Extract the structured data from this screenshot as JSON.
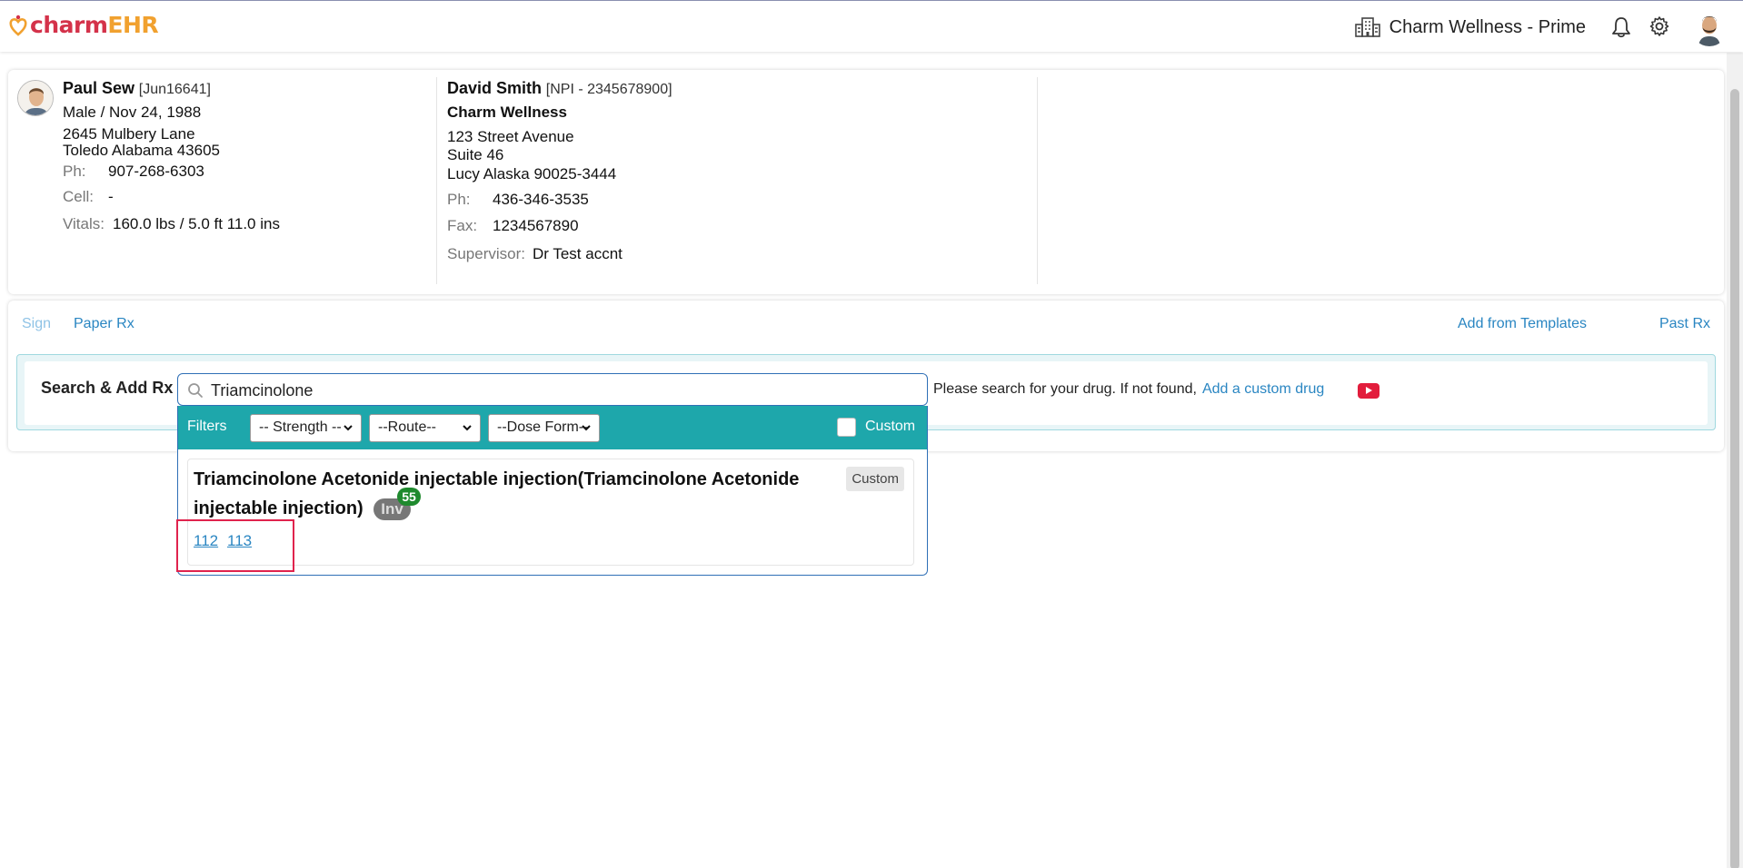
{
  "header": {
    "logo_charm": "charm",
    "logo_ehr": "EHR",
    "clinic_name": "Charm Wellness - Prime"
  },
  "patient": {
    "name": "Paul Sew",
    "id": "[Jun16641]",
    "gender_dob": "Male / Nov 24, 1988",
    "address_line1": "2645 Mulbery Lane",
    "address_line2": "Toledo Alabama 43605",
    "phone_label": "Ph:",
    "phone": "907-268-6303",
    "cell_label": "Cell:",
    "cell": "-",
    "vitals_label": "Vitals:",
    "vitals": "160.0 lbs / 5.0 ft 11.0 ins"
  },
  "provider": {
    "name": "David Smith",
    "npi": "[NPI - 2345678900]",
    "facility": "Charm Wellness",
    "address_line1": "123 Street Avenue",
    "address_line2": "Suite 46",
    "address_line3": "Lucy Alaska 90025-3444",
    "phone_label": "Ph:",
    "phone": "436-346-3535",
    "fax_label": "Fax:",
    "fax": "1234567890",
    "supervisor_label": "Supervisor:",
    "supervisor": "Dr Test accnt"
  },
  "tabs": {
    "sign": "Sign",
    "paper_rx": "Paper Rx",
    "add_from_templates": "Add from Templates",
    "past_rx": "Past Rx"
  },
  "search": {
    "label": "Search & Add Rx",
    "value": "Triamcinolone",
    "hint": "Please search for your drug. If not found,",
    "custom_link": "Add a custom drug"
  },
  "filters": {
    "label": "Filters",
    "strength": "-- Strength --",
    "route": "--Route--",
    "dose_form": "--Dose Form--",
    "custom_label": "Custom",
    "custom_checked": false
  },
  "result": {
    "drug_name": "Triamcinolone Acetonide injectable injection(Triamcinolone Acetonide injectable injection)",
    "inv_label": "Inv",
    "inv_count": "55",
    "custom_tag": "Custom",
    "codes": [
      "112",
      "113"
    ]
  },
  "colors": {
    "brand_red": "#d4324a",
    "brand_orange": "#f1a12f",
    "filter_teal": "#1ea7ab",
    "link_blue": "#2a86c2",
    "highlight": "#e0234d"
  }
}
